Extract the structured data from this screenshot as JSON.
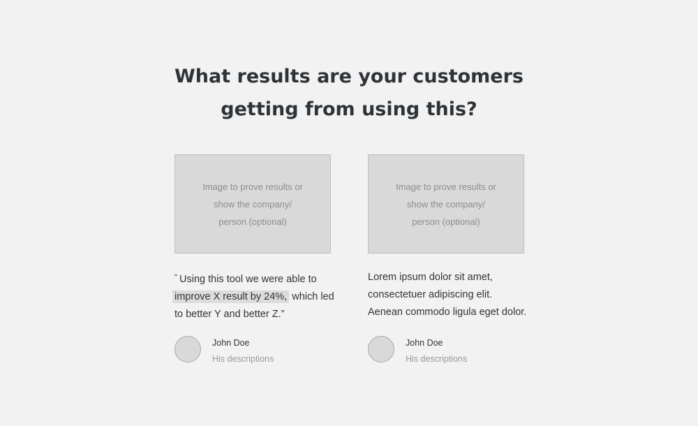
{
  "heading": {
    "line1": "What results are your customers",
    "line2": "getting from using this?"
  },
  "cards": [
    {
      "image_text": [
        "Image to prove results or",
        "show the company/",
        "person (optional)"
      ],
      "quote": {
        "open_mark": "“",
        "line1": "Using this tool we were able to",
        "highlight": "improve X result by 24%,",
        "line2_rest": " which led",
        "line3": "to better Y and better Z.",
        "close_mark": "”"
      },
      "author": {
        "name": "John Doe",
        "description": "His descriptions"
      }
    },
    {
      "image_text": [
        "Image to prove results or",
        "show the company/",
        "person (optional)"
      ],
      "body": {
        "line1": "Lorem ipsum dolor sit amet,",
        "line2": "consectetuer adipiscing elit.",
        "line3": "Aenean commodo ligula eget dolor."
      },
      "author": {
        "name": "John Doe",
        "description": "His descriptions"
      }
    }
  ]
}
